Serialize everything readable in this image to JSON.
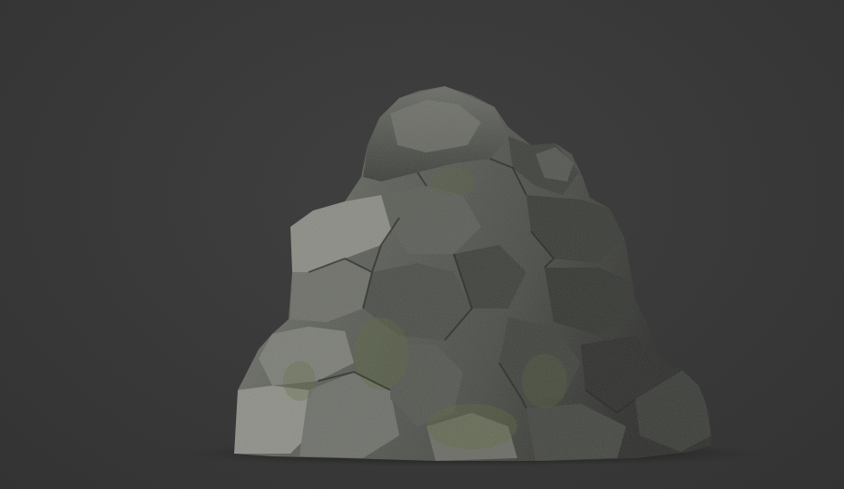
{
  "scene": {
    "subject": "rock-model",
    "colors": {
      "background": "#3a3a3a",
      "rock_light": "#8f9088",
      "rock_mid": "#5f615b",
      "rock_dark": "#2c2d2a",
      "moss": "#5c6a3c"
    }
  }
}
